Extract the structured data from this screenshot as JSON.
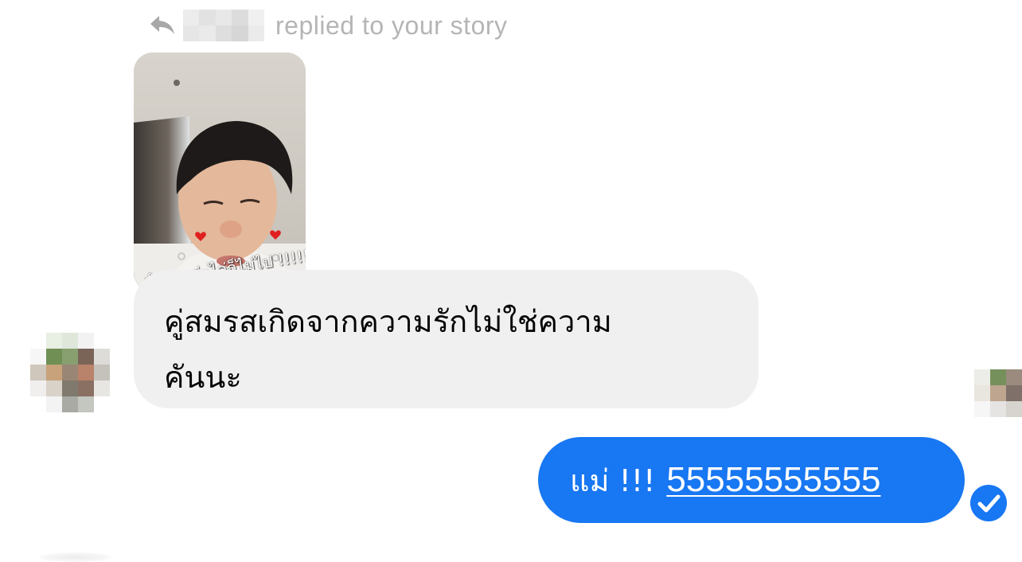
{
  "reply_header": {
    "icon": "reply-arrow-icon",
    "text": "replied to your story"
  },
  "story": {
    "caption": "ลำคานว่ะไล่ก็ไม่ไป !!!!!"
  },
  "incoming_message": {
    "lines": [
      "คู่สมรสเกิดจากความรักไม่ใช่ความ",
      "คันนะ"
    ]
  },
  "outgoing_message": {
    "prefix": "แม่ !!!",
    "link_text": "55555555555"
  },
  "read_receipt": {
    "icon": "check-circle-icon"
  },
  "colors": {
    "outgoing_bubble": "#1877f2",
    "incoming_bubble": "#f0f0f0",
    "muted_text": "#b5b5b5",
    "text": "#050505"
  }
}
